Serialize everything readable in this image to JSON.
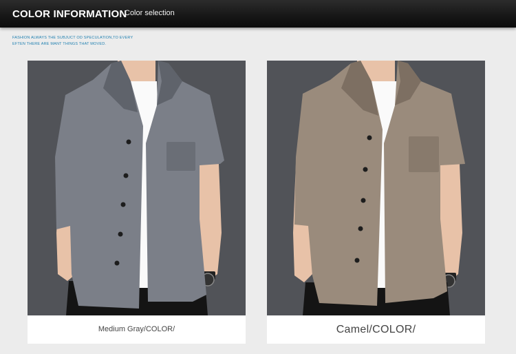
{
  "header": {
    "title": "COLOR INFORMATION",
    "subtitle": "Color selection"
  },
  "tagline": {
    "line1": "FASHION ALWAYS THE  SUBJUCT OD SPECULATION,TO EVERY",
    "line2": "EFTEN THERE ARE MANT THINGS THAT MOVED."
  },
  "products": [
    {
      "caption": "Medium Gray/COLOR/",
      "shirt_color": "#7b7f88",
      "shirt_shade": "#5f636b"
    },
    {
      "caption": "Camel/COLOR/",
      "shirt_color": "#9a8b7c",
      "shirt_shade": "#7d6f62"
    }
  ],
  "colors": {
    "backdrop": "#515358",
    "skin": "#e8c2a8",
    "tshirt": "#fafafa",
    "pants": "#141414",
    "accent_text": "#1e7fb0"
  }
}
